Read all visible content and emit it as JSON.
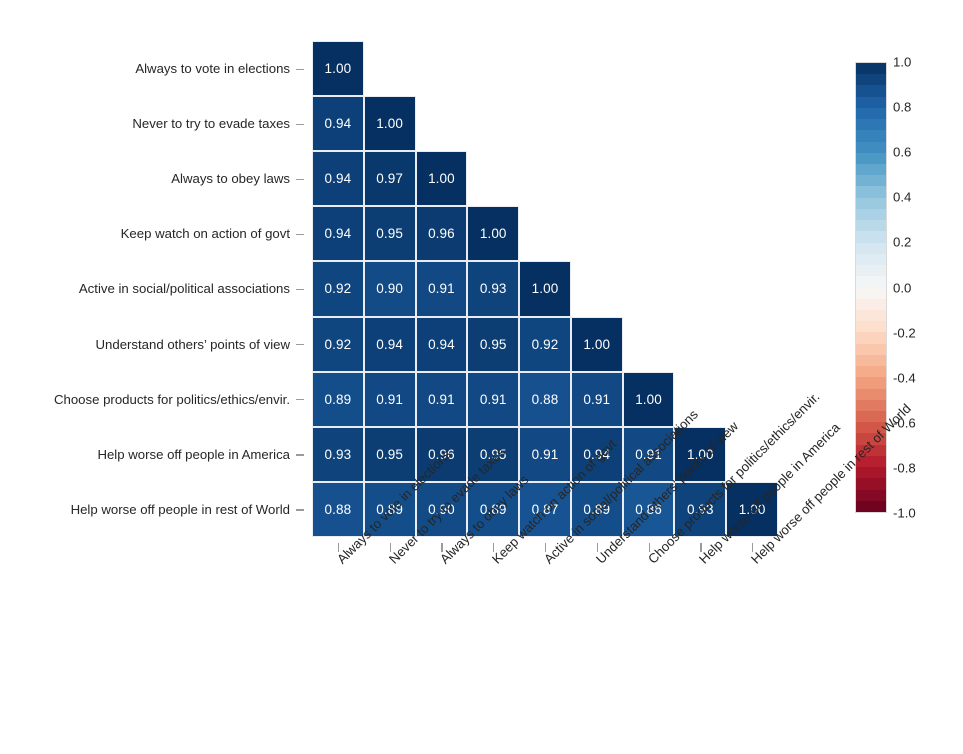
{
  "chart_data": {
    "type": "heatmap",
    "title": "",
    "subtitle": "",
    "xlabel": "",
    "ylabel": "",
    "grid": false,
    "legend_position": "right",
    "shape": "lower-triangular",
    "cell_text_format": "2 decimal places",
    "categories": [
      "Always to vote in elections",
      "Never to try to evade taxes",
      "Always to obey laws",
      "Keep watch on action of govt",
      "Active in social/political associations",
      "Understand others’ points of view",
      "Choose products for politics/ethics/envir.",
      "Help worse off people in America",
      "Help worse off people in rest of World"
    ],
    "x_tick_labels": [
      "Always to vote in elections",
      "Never to try to evade taxes",
      "Always to obey laws",
      "Keep watch on action of govt",
      "Active in social/political associations",
      "Understand others’ points of view",
      "Choose products for politics/ethics/envir.",
      "Help worse off people in America",
      "Help worse off people in rest of World"
    ],
    "y_tick_labels": [
      "Always to vote in elections",
      "Never to try to evade taxes",
      "Always to obey laws",
      "Keep watch on action of govt",
      "Active in social/political associations",
      "Understand others’ points of view",
      "Choose products for politics/ethics/envir.",
      "Help worse off people in America",
      "Help worse off people in rest of World"
    ],
    "matrix": [
      [
        1.0,
        null,
        null,
        null,
        null,
        null,
        null,
        null,
        null
      ],
      [
        0.94,
        1.0,
        null,
        null,
        null,
        null,
        null,
        null,
        null
      ],
      [
        0.94,
        0.97,
        1.0,
        null,
        null,
        null,
        null,
        null,
        null
      ],
      [
        0.94,
        0.95,
        0.96,
        1.0,
        null,
        null,
        null,
        null,
        null
      ],
      [
        0.92,
        0.9,
        0.91,
        0.93,
        1.0,
        null,
        null,
        null,
        null
      ],
      [
        0.92,
        0.94,
        0.94,
        0.95,
        0.92,
        1.0,
        null,
        null,
        null
      ],
      [
        0.89,
        0.91,
        0.91,
        0.91,
        0.88,
        0.91,
        1.0,
        null,
        null
      ],
      [
        0.93,
        0.95,
        0.96,
        0.95,
        0.91,
        0.94,
        0.91,
        1.0,
        null
      ],
      [
        0.88,
        0.89,
        0.9,
        0.89,
        0.87,
        0.89,
        0.86,
        0.93,
        1.0
      ]
    ],
    "cell_labels": [
      [
        "1.00",
        "",
        "",
        "",
        "",
        "",
        "",
        "",
        ""
      ],
      [
        "0.94",
        "1.00",
        "",
        "",
        "",
        "",
        "",
        "",
        ""
      ],
      [
        "0.94",
        "0.97",
        "1.00",
        "",
        "",
        "",
        "",
        "",
        ""
      ],
      [
        "0.94",
        "0.95",
        "0.96",
        "1.00",
        "",
        "",
        "",
        "",
        ""
      ],
      [
        "0.92",
        "0.90",
        "0.91",
        "0.93",
        "1.00",
        "",
        "",
        "",
        ""
      ],
      [
        "0.92",
        "0.94",
        "0.94",
        "0.95",
        "0.92",
        "1.00",
        "",
        "",
        ""
      ],
      [
        "0.89",
        "0.91",
        "0.91",
        "0.91",
        "0.88",
        "0.91",
        "1.00",
        "",
        ""
      ],
      [
        "0.93",
        "0.95",
        "0.96",
        "0.95",
        "0.91",
        "0.94",
        "0.91",
        "1.00",
        ""
      ],
      [
        "0.88",
        "0.89",
        "0.90",
        "0.89",
        "0.87",
        "0.89",
        "0.86",
        "0.93",
        "1.00"
      ]
    ],
    "colorbar": {
      "vmin": -1.0,
      "vmax": 1.0,
      "colormap": "RdBu",
      "reversed": true,
      "n_bands": 40,
      "tick_values": [
        1.0,
        0.8,
        0.6,
        0.4,
        0.2,
        0.0,
        -0.2,
        -0.4,
        -0.6,
        -0.8,
        -1.0
      ],
      "tick_labels": [
        "1.0",
        "0.8",
        "0.6",
        "0.4",
        "0.2",
        "0.0",
        "-0.2",
        "-0.4",
        "-0.6",
        "-0.8",
        "-1.0"
      ]
    },
    "colors": {
      "background": "#ffffff",
      "text": "#262626",
      "cell_text": "#ffffff",
      "cell_border": "#e9edf2",
      "tick_mark": "#9a9a9a",
      "cmap_high": "#053061",
      "cmap_mid": "#f7f7f7",
      "cmap_low": "#67001f"
    }
  }
}
